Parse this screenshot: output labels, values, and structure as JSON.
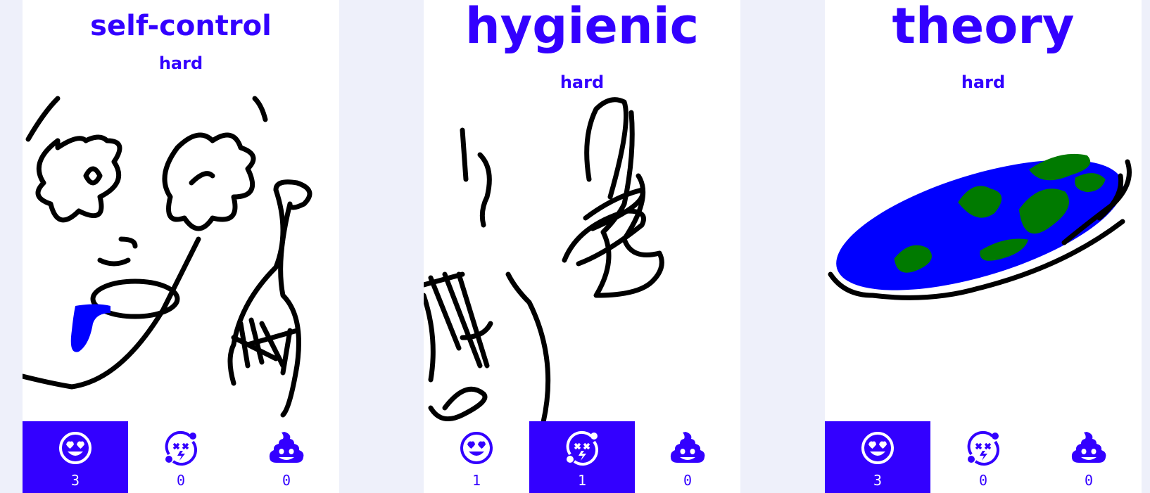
{
  "cards": [
    {
      "word": "self-control",
      "difficulty": "hard",
      "votes": [
        {
          "icon": "heart-eyes-face-icon",
          "count": "3",
          "selected": true
        },
        {
          "icon": "dizzy-face-icon",
          "count": "0",
          "selected": false
        },
        {
          "icon": "poop-icon",
          "count": "0",
          "selected": false
        }
      ]
    },
    {
      "word": "hygienic",
      "difficulty": "hard",
      "votes": [
        {
          "icon": "heart-eyes-face-icon",
          "count": "1",
          "selected": false
        },
        {
          "icon": "dizzy-face-icon",
          "count": "1",
          "selected": true
        },
        {
          "icon": "poop-icon",
          "count": "0",
          "selected": false
        }
      ]
    },
    {
      "word": "theory",
      "difficulty": "hard",
      "votes": [
        {
          "icon": "heart-eyes-face-icon",
          "count": "3",
          "selected": true
        },
        {
          "icon": "dizzy-face-icon",
          "count": "0",
          "selected": false
        },
        {
          "icon": "poop-icon",
          "count": "0",
          "selected": false
        }
      ]
    }
  ],
  "colors": {
    "accent": "#3300ff",
    "background": "#eef0fa",
    "card": "#ffffff",
    "ink": "#000000",
    "globe_water": "#0000ff",
    "globe_land": "#007a00"
  }
}
